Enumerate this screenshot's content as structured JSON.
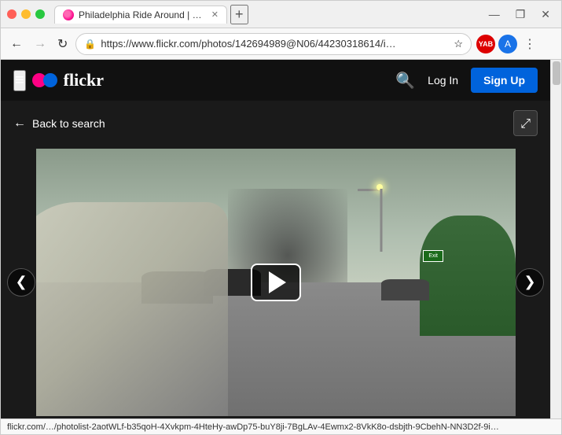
{
  "browser": {
    "title_bar": {
      "tab_title": "Philadelphia Ride Around | Ride …",
      "new_tab_label": "+",
      "minimize": "—",
      "maximize": "❐",
      "close": "✕"
    },
    "nav_bar": {
      "back_tooltip": "Back",
      "forward_tooltip": "Forward",
      "reload_tooltip": "Reload",
      "url": "https://www.flickr.com/photos/142694989@N06/44230318614/i…",
      "lock_icon": "🔒",
      "bookmark_icon": "☆",
      "menu_icon": "⋮"
    },
    "status": "flickr.com/…/photolist-2aotWLf-b35qoH-4Xvkpm-4HteHy-awDp75-buY8ji-7BgLAv-4Ewmx2-8VkK8o-dsbjth-9CbehN-NN3D2f-9i…"
  },
  "flickr": {
    "logo_text": "flickr",
    "menu_icon": "≡",
    "search_placeholder": "Search",
    "log_in_label": "Log In",
    "sign_up_label": "Sign Up",
    "back_to_search": "Back to search",
    "expand_icon": "⤢",
    "prev_icon": "❮",
    "next_icon": "❯"
  }
}
